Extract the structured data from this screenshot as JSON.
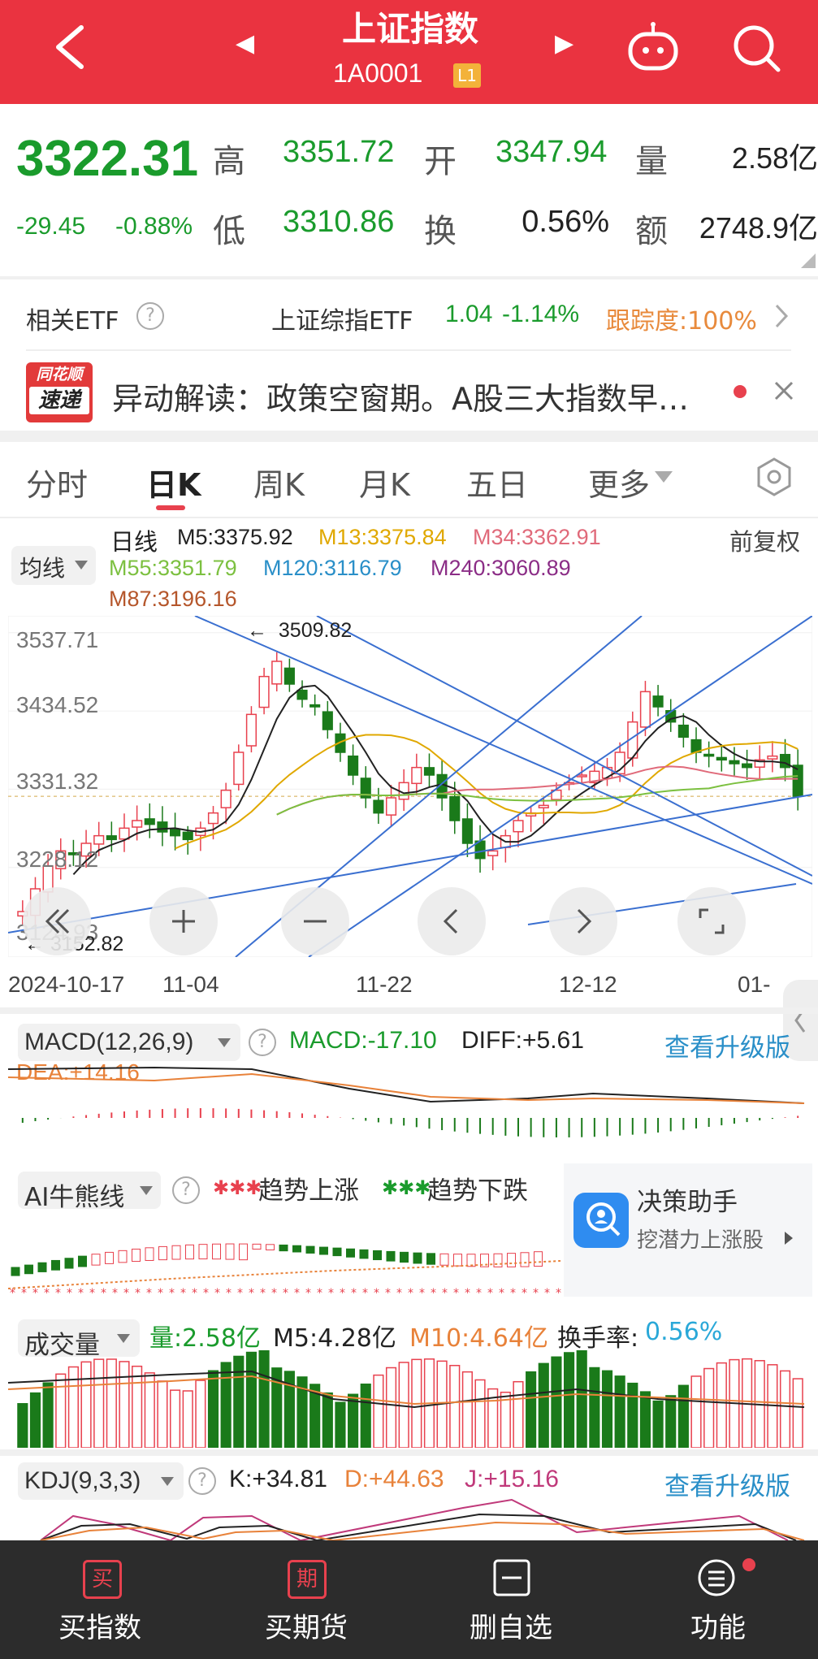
{
  "header": {
    "title": "上证指数",
    "code": "1A0001",
    "level_badge": "L1",
    "prev_arrow": "◀",
    "next_arrow": "▶"
  },
  "quote": {
    "price": "3322.31",
    "change": "-29.45",
    "change_pct": "-0.88%",
    "high_label": "高",
    "high": "3351.72",
    "open_label": "开",
    "open": "3347.94",
    "vol_label": "量",
    "vol": "2.58亿",
    "low_label": "低",
    "low": "3310.86",
    "turnover_label": "换",
    "turnover": "0.56%",
    "amount_label": "额",
    "amount": "2748.9亿"
  },
  "etf": {
    "label": "相关ETF",
    "name": "上证综指ETF",
    "price": "1.04",
    "change": "-1.14%",
    "tracking": "跟踪度:100%"
  },
  "news": {
    "logo_line1": "同花顺",
    "logo_line2": "速递",
    "text": "异动解读：政策空窗期。A股三大指数早…"
  },
  "tabs": [
    "分时",
    "日K",
    "周K",
    "月K",
    "五日",
    "更多"
  ],
  "ma": {
    "selector": "均线",
    "line_label": "日线",
    "m5": "M5:3375.92",
    "m13": "M13:3375.84",
    "m34": "M34:3362.91",
    "m55": "M55:3351.79",
    "m120": "M120:3116.79",
    "m240": "M240:3060.89",
    "m87": "M87:3196.16",
    "adjust": "前复权",
    "colors": {
      "m5": "#222222",
      "m13": "#e0a800",
      "m34": "#e06a7a",
      "m55": "#7cc040",
      "m120": "#2a8fc8",
      "m240": "#8b2d86",
      "m87": "#b5562b"
    }
  },
  "chart": {
    "y_labels": [
      "3537.71",
      "3434.52",
      "3331.32",
      "3228.12",
      "3124.93"
    ],
    "high_note": "3509.82",
    "low_note": "3152.82",
    "x_labels": [
      "2024-10-17",
      "11-04",
      "11-22",
      "12-12",
      "01-"
    ]
  },
  "macd": {
    "title": "MACD(12,26,9)",
    "macd": "MACD:-17.10",
    "diff": "DIFF:+5.61",
    "dea": "DEA:+14.16",
    "upgrade": "查看升级版"
  },
  "ai": {
    "title": "AI牛熊线",
    "up_label": "趋势上涨",
    "down_label": "趋势下跌",
    "assist_title": "决策助手",
    "assist_sub": "挖潜力上涨股"
  },
  "volume": {
    "title": "成交量",
    "vol": "量:2.58亿",
    "m5": "M5:4.28亿",
    "m10": "M10:4.64亿",
    "turnover_label": "换手率:",
    "turnover": "0.56%"
  },
  "kdj": {
    "title": "KDJ(9,3,3)",
    "k": "K:+34.81",
    "d": "D:+44.63",
    "j": "J:+15.16",
    "upgrade": "查看升级版"
  },
  "bottom": {
    "buy_index_icon": "买",
    "buy_index": "买指数",
    "buy_futures_icon": "期",
    "buy_futures": "买期货",
    "remove_fav": "删自选",
    "functions": "功能"
  },
  "colors": {
    "up": "#e8414e",
    "down": "#1a7a1a",
    "green_text": "#1a9b2c",
    "header": "#ea3340",
    "link": "#2a8fc8"
  }
}
